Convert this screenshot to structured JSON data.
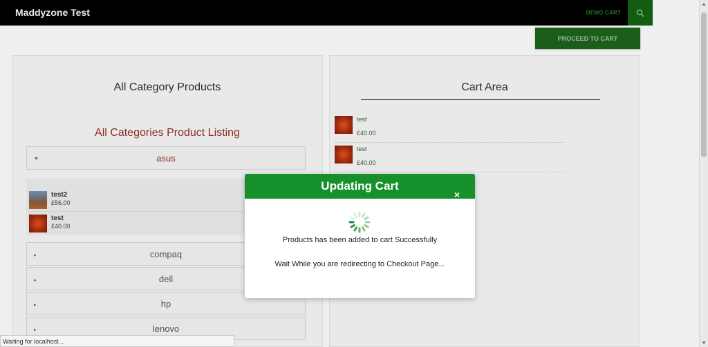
{
  "header": {
    "brand": "Maddyzone Test",
    "demo_cart": "DEMO CART",
    "search_icon": "search-icon"
  },
  "proceed_button": "PROCEED TO CART",
  "left": {
    "title": "All Category Products",
    "listing_title": "All Categories Product Listing",
    "categories": [
      {
        "label": "asus",
        "expanded": true
      },
      {
        "label": "compaq",
        "expanded": false
      },
      {
        "label": "dell",
        "expanded": false
      },
      {
        "label": "hp",
        "expanded": false
      },
      {
        "label": "lenovo",
        "expanded": false
      }
    ],
    "products": [
      {
        "name": "test2",
        "price": "£56.00"
      },
      {
        "name": "test",
        "price": "£40.00"
      }
    ]
  },
  "right": {
    "title": "Cart Area",
    "items": [
      {
        "name": "test",
        "price": "£40.00"
      },
      {
        "name": "test",
        "price": "£40.00"
      }
    ]
  },
  "modal": {
    "title": "Updating Cart",
    "close": "×",
    "message1": "Products has been added to cart Successfully",
    "message2": "Wait While you are redirecting to Checkout Page..."
  },
  "status": "Waiting for localhost...",
  "colors": {
    "modal_header": "#16902a",
    "accent_green": "#1a5e1a",
    "listing_red": "#8b2d1f"
  }
}
